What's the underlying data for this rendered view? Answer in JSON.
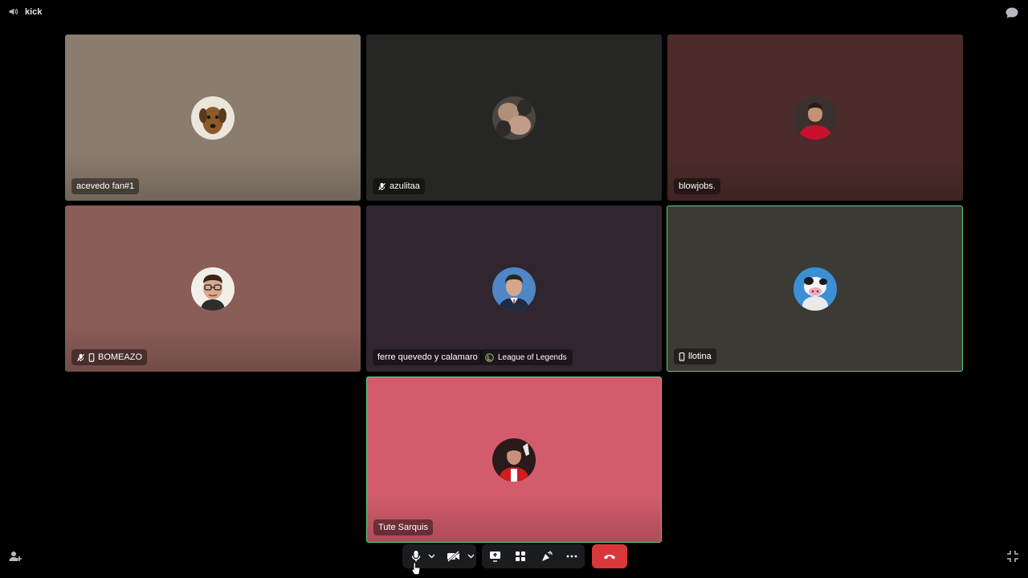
{
  "channel": {
    "name": "kick",
    "icon": "speaker-icon"
  },
  "colors": {
    "background": "#000000",
    "speaking_border": "#5fcf7c",
    "hangup": "#da373c",
    "control_bg": "#1b1c1f"
  },
  "participants": [
    {
      "name": "acevedo fan#1",
      "tile_color": "#8a7c6e",
      "muted": false,
      "mobile": false,
      "speaking": false
    },
    {
      "name": "azulitaa",
      "tile_color": "#262624",
      "muted": true,
      "mobile": false,
      "speaking": false
    },
    {
      "name": "blowjobs.",
      "tile_color": "#4c2b2b",
      "muted": false,
      "mobile": false,
      "speaking": false
    },
    {
      "name": "BOMEAZO",
      "tile_color": "#8b5d57",
      "muted": true,
      "mobile": true,
      "speaking": false
    },
    {
      "name": "ferre quevedo y calamaro",
      "tile_color": "#312530",
      "muted": false,
      "mobile": false,
      "speaking": false,
      "activity": {
        "label": "League of Legends",
        "icon": "league-of-legends-icon"
      }
    },
    {
      "name": "llotina",
      "tile_color": "#3b3a35",
      "muted": false,
      "mobile": true,
      "speaking": true
    },
    {
      "name": "Tute Sarquis",
      "tile_color": "#d35c6c",
      "muted": false,
      "mobile": false,
      "speaking": true
    }
  ],
  "controls": {
    "microphone": "microphone-icon",
    "microphone_options": "chevron-down-icon",
    "camera": "camera-off-icon",
    "camera_options": "chevron-down-icon",
    "share_screen": "screen-share-icon",
    "activities": "activities-icon",
    "soundboard": "soundboard-icon",
    "more": "more-icon",
    "disconnect": "hang-up-icon"
  },
  "corners": {
    "left": "invite-icon",
    "right": "exit-fullscreen-icon"
  }
}
